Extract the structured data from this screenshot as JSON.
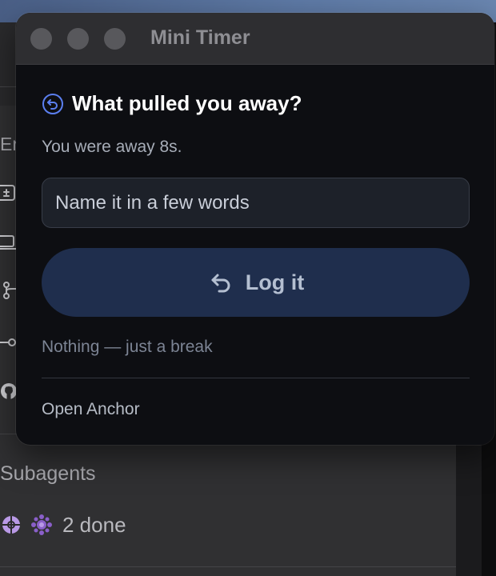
{
  "window": {
    "title": "Mini Timer"
  },
  "prompt": {
    "heading": "What pulled you away?",
    "heading_icon": "undo-circle-icon",
    "away_text": "You were away 8s."
  },
  "input": {
    "value": "",
    "placeholder": "Name it in a few words"
  },
  "actions": {
    "log_label": "Log it",
    "log_icon": "undo-arrow-icon",
    "break_label": "Nothing — just a break",
    "open_anchor_label": "Open Anchor"
  },
  "background": {
    "partial_label": "Er",
    "sidebar_icons": [
      "diff-icon",
      "laptop-icon",
      "git-branch-icon",
      "git-commit-icon",
      "github-icon"
    ],
    "subagents_title": "Subagents",
    "subagents_status": "2 done"
  },
  "colors": {
    "accent": "#5b7ff0",
    "button_bg": "#1f2e4d",
    "window_bg": "#0d0e12"
  }
}
